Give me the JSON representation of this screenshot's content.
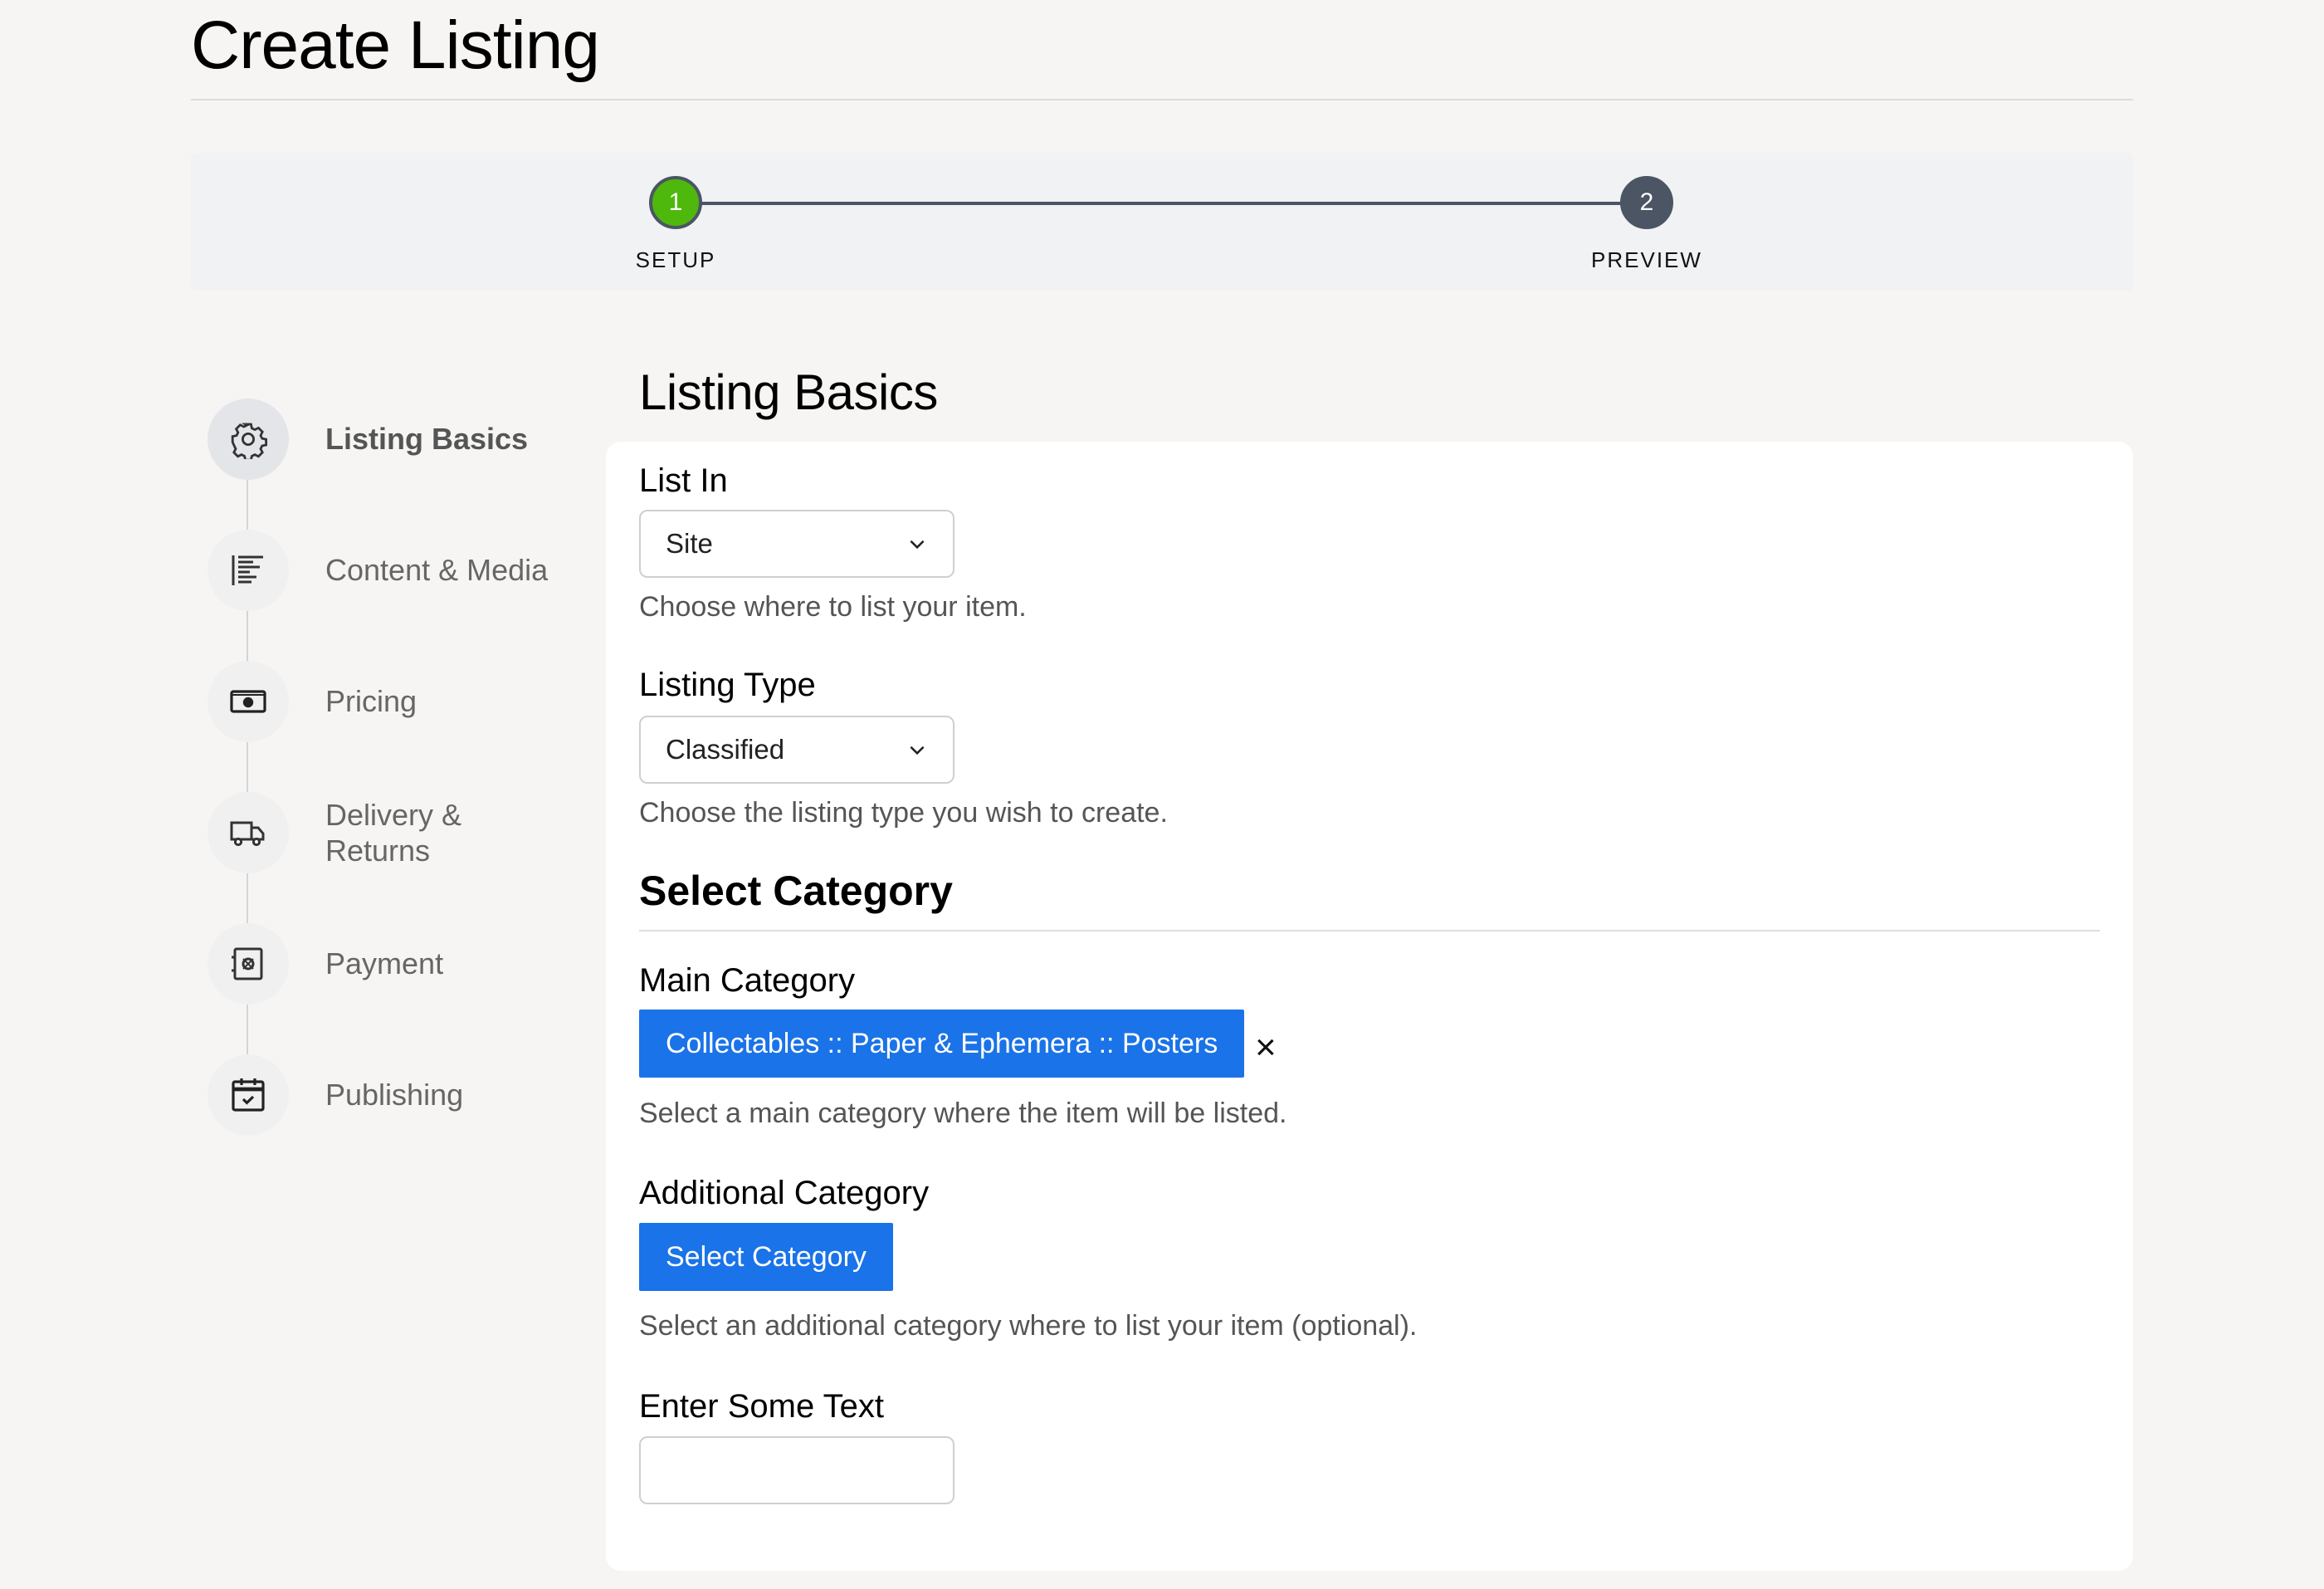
{
  "page": {
    "title": "Create Listing"
  },
  "stepper": {
    "steps": [
      {
        "number": "1",
        "label": "SETUP",
        "state": "complete",
        "color": "#4fb80c"
      },
      {
        "number": "2",
        "label": "PREVIEW",
        "state": "upcoming",
        "color": "#4b5563"
      }
    ]
  },
  "sidebar": {
    "items": [
      {
        "label": "Listing Basics",
        "icon": "gear-icon",
        "active": true
      },
      {
        "label": "Content & Media",
        "icon": "text-align-icon",
        "active": false
      },
      {
        "label": "Pricing",
        "icon": "banknote-icon",
        "active": false
      },
      {
        "label": "Delivery & Returns",
        "icon": "truck-icon",
        "active": false
      },
      {
        "label": "Payment",
        "icon": "safe-icon",
        "active": false
      },
      {
        "label": "Publishing",
        "icon": "calendar-check-icon",
        "active": false
      }
    ]
  },
  "main": {
    "heading": "Listing Basics",
    "list_in": {
      "label": "List In",
      "value": "Site",
      "help": "Choose where to list your item."
    },
    "listing_type": {
      "label": "Listing Type",
      "value": "Classified",
      "help": "Choose the listing type you wish to create."
    },
    "select_category_heading": "Select Category",
    "main_category": {
      "label": "Main Category",
      "value": "Collectables :: Paper & Ephemera :: Posters",
      "clear": "×",
      "help": "Select a main category where the item will be listed."
    },
    "additional_category": {
      "label": "Additional Category",
      "button": "Select Category",
      "help": "Select an additional category where to list your item (optional)."
    },
    "enter_text": {
      "label": "Enter Some Text",
      "value": ""
    }
  },
  "colors": {
    "accent": "#1a73e8",
    "step_complete": "#4fb80c",
    "step_pending": "#4b5563"
  }
}
